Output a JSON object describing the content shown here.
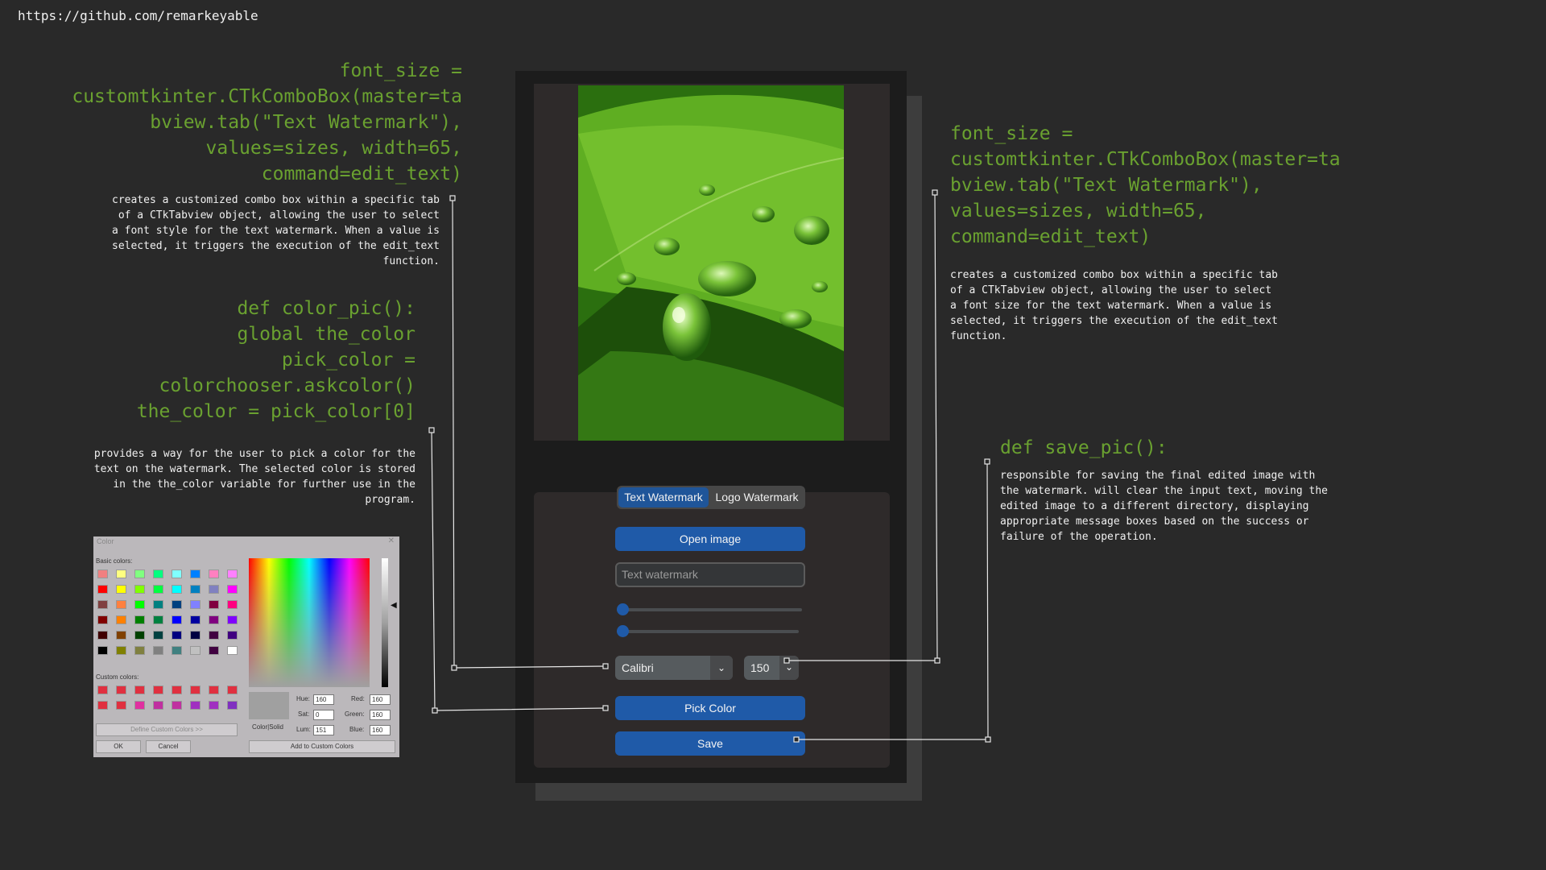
{
  "url": "https://github.com/remarkeyable",
  "annotations": {
    "font_style_code": [
      "font_size =",
      "customtkinter.CTkComboBox(master=ta",
      "bview.tab(\"Text Watermark\"),",
      "values=sizes, width=65,",
      "command=edit_text)"
    ],
    "font_style_desc": [
      "creates a customized combo box within a specific tab",
      "of a CTkTabview object, allowing the user to select",
      "a font style for the text watermark. When a value is",
      "selected, it triggers the execution of the edit_text",
      "function."
    ],
    "color_code": [
      "def color_pic():",
      "global the_color",
      "pick_color =",
      "colorchooser.askcolor()",
      "the_color = pick_color[0]"
    ],
    "color_desc": [
      "provides a way for the user to pick a color for the",
      "text on the watermark. The selected color is stored",
      "in the the_color variable for further use in the",
      "program."
    ],
    "font_size_code": [
      "font_size =",
      "customtkinter.CTkComboBox(master=ta",
      "bview.tab(\"Text Watermark\"),",
      "values=sizes, width=65,",
      "command=edit_text)"
    ],
    "font_size_desc": [
      "creates a customized combo box within a specific tab",
      "of a CTkTabview object, allowing the user to select",
      "a font size for the text watermark. When a value is",
      "selected, it triggers the execution of the edit_text",
      "function."
    ],
    "save_code": [
      "def save_pic():"
    ],
    "save_desc": [
      "responsible for saving the final edited image with",
      "the watermark. will clear the input text, moving the",
      "edited image to a different directory, displaying",
      "appropriate message boxes based on the success or",
      "failure of the operation."
    ]
  },
  "app": {
    "tabs": [
      {
        "label": "Text Watermark",
        "active": true
      },
      {
        "label": "Logo Watermark",
        "active": false
      }
    ],
    "open_image_label": "Open image",
    "text_watermark_placeholder": "Text watermark",
    "sliders": [
      {
        "value_fraction": 0.02
      },
      {
        "value_fraction": 0.02
      }
    ],
    "font_combo_value": "Calibri",
    "size_combo_value": "150",
    "pick_color_label": "Pick Color",
    "save_label": "Save",
    "accent_color": "#1f5aa8"
  },
  "color_dialog": {
    "title": "Color",
    "close": "✕",
    "basic_colors_label": "Basic colors:",
    "custom_colors_label": "Custom colors:",
    "define_custom_label": "Define Custom Colors >>",
    "ok_label": "OK",
    "cancel_label": "Cancel",
    "add_custom_label": "Add to Custom Colors",
    "color_solid_label": "Color|Solid",
    "fields": {
      "hue": {
        "label": "Hue:",
        "value": "160"
      },
      "sat": {
        "label": "Sat:",
        "value": "0"
      },
      "lum": {
        "label": "Lum:",
        "value": "151"
      },
      "red": {
        "label": "Red:",
        "value": "160"
      },
      "green": {
        "label": "Green:",
        "value": "160"
      },
      "blue": {
        "label": "Blue:",
        "value": "160"
      }
    },
    "basic_colors": [
      [
        "#f08080",
        "#ffff80",
        "#80ff80",
        "#00ff80",
        "#80ffff",
        "#0080ff",
        "#ff80c0",
        "#ff80ff"
      ],
      [
        "#ff0000",
        "#ffff00",
        "#80ff00",
        "#00ff40",
        "#00ffff",
        "#0080c0",
        "#8080c0",
        "#ff00ff"
      ],
      [
        "#804040",
        "#ff8040",
        "#00ff00",
        "#008080",
        "#004080",
        "#8080ff",
        "#800040",
        "#ff0080"
      ],
      [
        "#800000",
        "#ff8000",
        "#008000",
        "#008040",
        "#0000ff",
        "#0000a0",
        "#800080",
        "#8000ff"
      ],
      [
        "#400000",
        "#804000",
        "#004000",
        "#004040",
        "#000080",
        "#000040",
        "#400040",
        "#400080"
      ],
      [
        "#000000",
        "#808000",
        "#808040",
        "#808080",
        "#408080",
        "#c0c0c0",
        "#400040",
        "#ffffff"
      ]
    ],
    "custom_colors": [
      [
        "#e03040",
        "#e03040",
        "#e03040",
        "#e03040",
        "#e03040",
        "#e03040",
        "#e03040",
        "#e03040"
      ],
      [
        "#e03040",
        "#e03040",
        "#e030a0",
        "#c030a0",
        "#c030a0",
        "#a030c0",
        "#a030c0",
        "#8030c0"
      ]
    ],
    "preview_color": "#a0a0a0"
  }
}
